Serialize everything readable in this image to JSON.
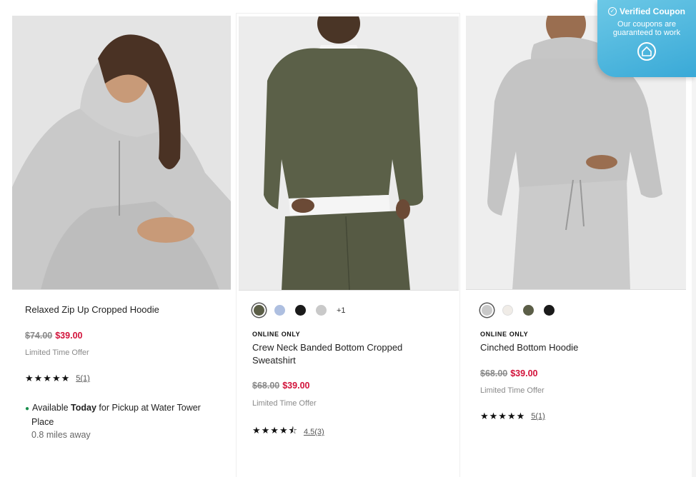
{
  "coupon": {
    "title": "Verified Coupon",
    "subtitle_line1": "Our coupons are",
    "subtitle_line2": "guaranteed to work",
    "brand": "#45b1dc"
  },
  "products": [
    {
      "name": "Relaxed Zip Up Cropped Hoodie",
      "old_price": "$74.00",
      "new_price": "$39.00",
      "offer": "Limited Time Offer",
      "stars": "★★★★★",
      "rating_text": "5(1)",
      "pickup_available": "Available",
      "pickup_today": "Today",
      "pickup_rest": "for Pickup at Water Tower",
      "pickup_place": "Place",
      "pickup_miles": "0.8 miles away"
    },
    {
      "badge": "ONLINE ONLY",
      "name_line1": "Crew Neck Banded Bottom Cropped",
      "name_line2": "Sweatshirt",
      "old_price": "$68.00",
      "new_price": "$39.00",
      "offer": "Limited Time Offer",
      "stars": "★★★★⯪",
      "rating_text": "4.5(3)",
      "more_colors": "+1",
      "swatches": [
        "#5b5e47",
        "#aebfe0",
        "#1a1a1a",
        "#c9c9c9"
      ]
    },
    {
      "badge": "ONLINE ONLY",
      "name": "Cinched Bottom Hoodie",
      "old_price": "$68.00",
      "new_price": "$39.00",
      "offer": "Limited Time Offer",
      "stars": "★★★★★",
      "rating_text": "5(1)",
      "swatches": [
        "#c9c9c9",
        "#f0ece7",
        "#5b5e47",
        "#1a1a1a"
      ]
    }
  ]
}
